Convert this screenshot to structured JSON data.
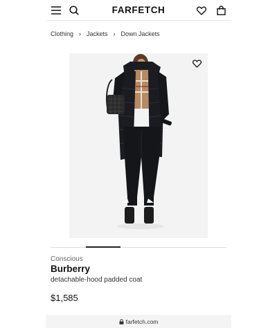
{
  "header": {
    "logo": "FARFETCH",
    "icons": {
      "menu": "menu-icon",
      "search": "search-icon",
      "wishlist": "heart-icon",
      "bag": "shopping-bag-icon"
    }
  },
  "breadcrumb": [
    "Clothing",
    "Jackets",
    "Down Jackets"
  ],
  "product": {
    "tag": "Conscious",
    "brand": "Burberry",
    "name": "detachable-hood padded coat",
    "price": "$1,585",
    "image_pagination": {
      "count": 5,
      "active": 1
    }
  },
  "browser": {
    "url": "farfetch.com"
  },
  "colors": {
    "text": "#222222",
    "accent": "#111111",
    "muted": "#666666",
    "image_bg": "#f3f3f3"
  }
}
